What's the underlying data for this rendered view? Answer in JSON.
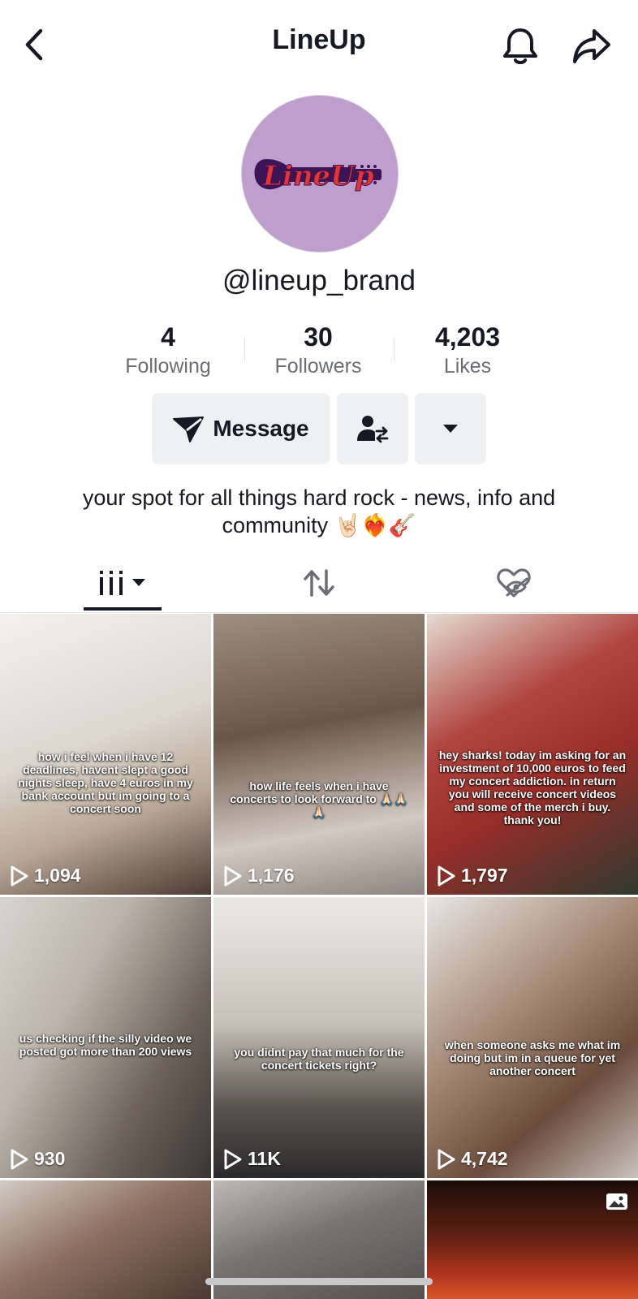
{
  "header": {
    "title": "LineUp"
  },
  "profile": {
    "avatar_logo_text": "LineUp",
    "handle": "@lineup_brand",
    "stats": [
      {
        "value": "4",
        "label": "Following"
      },
      {
        "value": "30",
        "label": "Followers"
      },
      {
        "value": "4,203",
        "label": "Likes"
      }
    ],
    "message_label": "Message",
    "bio": "your spot for all things hard rock - news, info and community 🤘🏻❤️‍🔥🎸"
  },
  "videos": [
    {
      "caption": "how i feel when i have 12 deadlines, havent slept a good nights sleep, have 4 euros in my bank account but im going to a concert soon",
      "views": "1,094"
    },
    {
      "caption": "how life feels when i have concerts to look forward to 🙏🏻🙏🏻🙏🏻",
      "views": "1,176"
    },
    {
      "caption": "hey sharks! today im asking for an investment of 10,000 euros to feed my concert addiction. in return you will receive concert videos and some of the merch i buy. thank you!",
      "views": "1,797"
    },
    {
      "caption": "us checking if the silly video we posted got more than 200 views",
      "views": "930"
    },
    {
      "caption": "you didnt pay that much for the concert tickets right?",
      "views": "11K"
    },
    {
      "caption": "when someone asks me what im doing but im in a queue for yet another concert",
      "views": "4,742"
    },
    {
      "caption": "",
      "views": ""
    },
    {
      "caption": "",
      "views": ""
    },
    {
      "caption": "",
      "views": ""
    }
  ],
  "colors": {
    "text": "#161823",
    "muted": "#6b6e76",
    "avatar_bg": "#bd9ecc",
    "logo_red": "#e8342f",
    "logo_dark": "#3d1456"
  }
}
